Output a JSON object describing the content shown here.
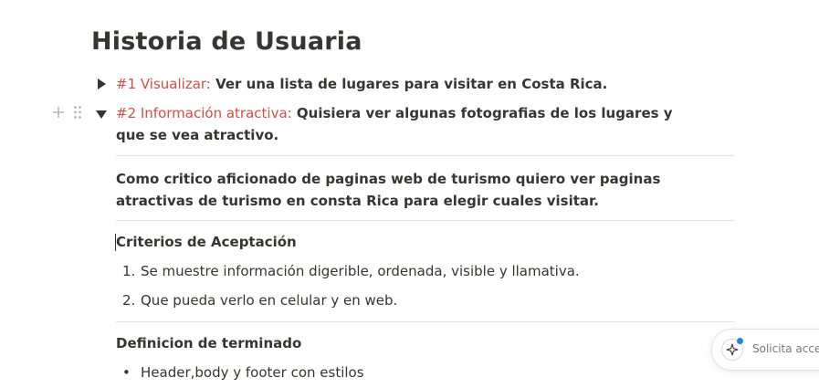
{
  "page": {
    "title": "Historia de Usuaria"
  },
  "stories": [
    {
      "tag": "#1 Visualizar:",
      "text": " Ver una lista de lugares para visitar en Costa Rica.",
      "expanded": false
    },
    {
      "tag": "#2 Información atractiva:",
      "text": " Quisiera ver algunas fotografias de los lugares y que se vea atractivo.",
      "expanded": true
    }
  ],
  "story2": {
    "description": "Como critico aficionado de paginas web de turismo quiero ver paginas atractivas de turismo en consta Rica para elegir cuales visitar.",
    "criteria_heading": "Criterios de Aceptación",
    "criteria": [
      {
        "num": "1.",
        "text": "Se muestre información digerible, ordenada, visible y llamativa."
      },
      {
        "num": "2.",
        "text": "Que pueda verlo en celular y en web."
      }
    ],
    "done_heading": "Definicion de terminado",
    "done_items": [
      {
        "text": "Header,body y footer con estilos"
      }
    ]
  },
  "ai_assistant": {
    "label": "Solicita acce"
  },
  "colors": {
    "tag": "#d44c47",
    "text": "#37352f",
    "divider": "#e3e2e0",
    "accent": "#2383e2"
  }
}
